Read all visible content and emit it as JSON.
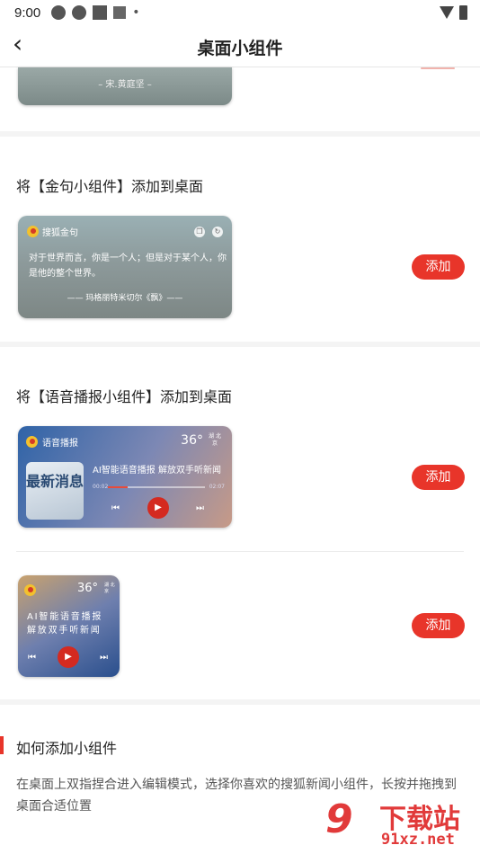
{
  "status_bar": {
    "time": "9:00",
    "dot": "•"
  },
  "nav": {
    "back_glyph": "‹",
    "title": "桌面小组件"
  },
  "sections": {
    "poem": {
      "author": "– 宋.黄庭坚 –"
    },
    "quote": {
      "title": "将【金句小组件】添加到桌面",
      "brand": "搜狐金句",
      "text": "对于世界而言，你是一个人；但是对于某个人，你是他的整个世界。",
      "author": "—— 玛格丽特米切尔《飘》——",
      "add_label": "添加"
    },
    "audio": {
      "title": "将【语音播报小组件】添加到桌面",
      "brand": "语音播报",
      "temperature": "36°",
      "location": "湖 北京",
      "news_label": "最新消息",
      "headline": "AI智能语音播报 解放双手听新闻",
      "time_start": "00:02",
      "time_end": "02:07",
      "progress": 0.2,
      "add_label": "添加"
    },
    "audio_small": {
      "temperature": "36°",
      "location": "湖 北京",
      "line1": "AI智能语音播报",
      "line2": "解放双手听新闻",
      "add_label": "添加"
    },
    "how_to": {
      "title": "如何添加小组件",
      "description": "在桌面上双指捏合进入编辑模式，选择你喜欢的搜狐新闻小组件，长按并拖拽到桌面合适位置"
    }
  },
  "watermark": {
    "digits": "9",
    "text": "下载站",
    "url": "91xz.net"
  },
  "colors": {
    "accent": "#e8352a"
  }
}
